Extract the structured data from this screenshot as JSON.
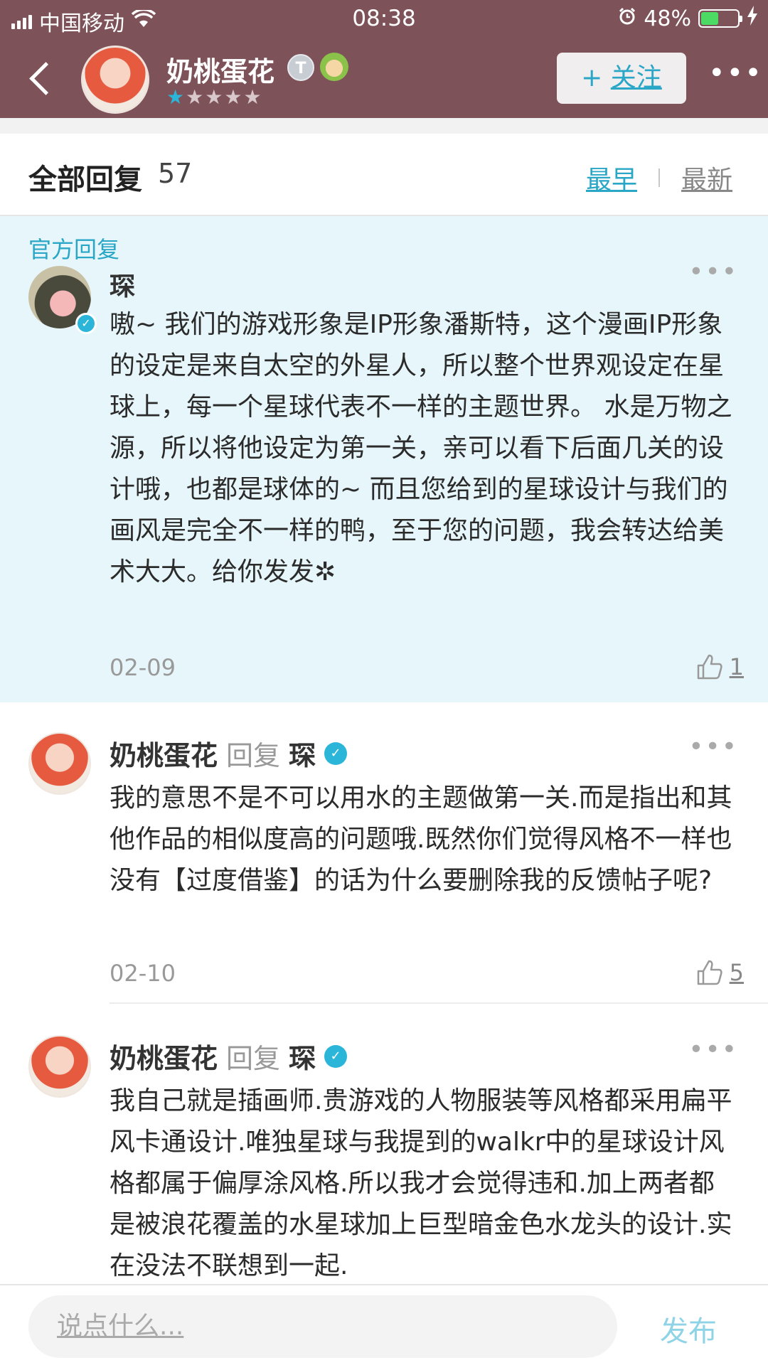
{
  "status": {
    "carrier": "中国移动",
    "time": "08:38",
    "battery": "48%"
  },
  "header": {
    "username": "奶桃蛋花",
    "badge_letter": "T",
    "stars_on": 1,
    "stars_total": 5,
    "follow_label": "关注",
    "follow_plus": "+",
    "more": "•••"
  },
  "section": {
    "title": "全部回复",
    "count": "57",
    "sort_early": "最早",
    "sort_new": "最新"
  },
  "official": {
    "label": "官方回复",
    "name": "琛",
    "text": "嗷~ 我们的游戏形象是IP形象潘斯特，这个漫画IP形象的设定是来自太空的外星人，所以整个世界观设定在星球上，每一个星球代表不一样的主题世界。 水是万物之源，所以将他设定为第一关，亲可以看下后面几关的设计哦，也都是球体的~ 而且您给到的星球设计与我们的画风是完全不一样的鸭，至于您的问题，我会转达给美术大大。给你发发✲",
    "date": "02-09",
    "likes": "1",
    "more": "•••"
  },
  "replies": [
    {
      "name": "奶桃蛋花",
      "reply_word": "回复",
      "to": "琛",
      "text": "我的意思不是不可以用水的主题做第一关.而是指出和其他作品的相似度高的问题哦.既然你们觉得风格不一样也没有【过度借鉴】的话为什么要删除我的反馈帖子呢?",
      "date": "02-10",
      "likes": "5",
      "more": "•••"
    },
    {
      "name": "奶桃蛋花",
      "reply_word": "回复",
      "to": "琛",
      "text": "我自己就是插画师.贵游戏的人物服装等风格都采用扁平风卡通设计.唯独星球与我提到的walkr中的星球设计风格都属于偏厚涂风格.所以我才会觉得违和.加上两者都是被浪花覆盖的水星球加上巨型暗金色水龙头的设计.实在没法不联想到一起.",
      "more": "•••"
    }
  ],
  "composer": {
    "placeholder": "说点什么...",
    "publish": "发布"
  },
  "colors": {
    "header_bg": "#7d5359",
    "accent": "#2aa6c6",
    "official_bg": "#e7f6fa"
  }
}
